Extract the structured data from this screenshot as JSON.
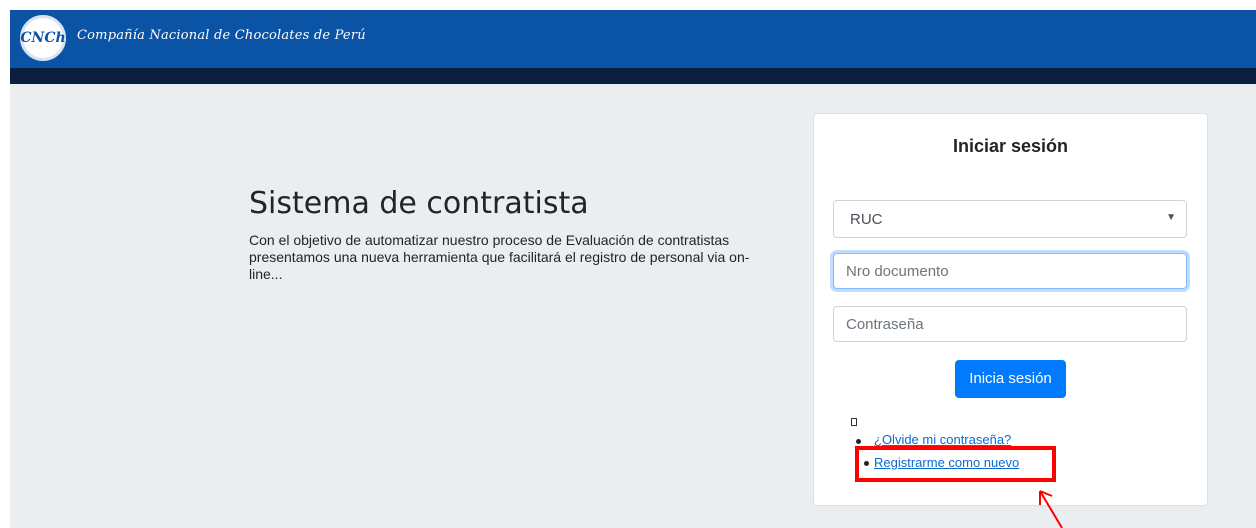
{
  "header": {
    "logo_text": "CNCh",
    "brand": "Compañía Nacional de Chocolates de Perú"
  },
  "hero": {
    "title": "Sistema de contratista",
    "description": "Con el objetivo de automatizar nuestro proceso de Evaluación de contratistas presentamos una nueva herramienta que facilitará el registro de personal via on-line..."
  },
  "login": {
    "title": "Iniciar sesión",
    "doc_type_selected": "RUC",
    "doc_number_placeholder": "Nro documento",
    "password_placeholder": "Contraseña",
    "submit_label": "Inicia sesión",
    "forgot_password_label": "¿Olvide mi contraseña?",
    "register_label": "Registrarme como nuevo"
  },
  "annotation": {
    "highlight_color": "#ff0000"
  },
  "colors": {
    "header": "#0b54a5",
    "header_bar": "#0a1f3f",
    "primary_button": "#007bff",
    "background": "#ebeef1"
  }
}
